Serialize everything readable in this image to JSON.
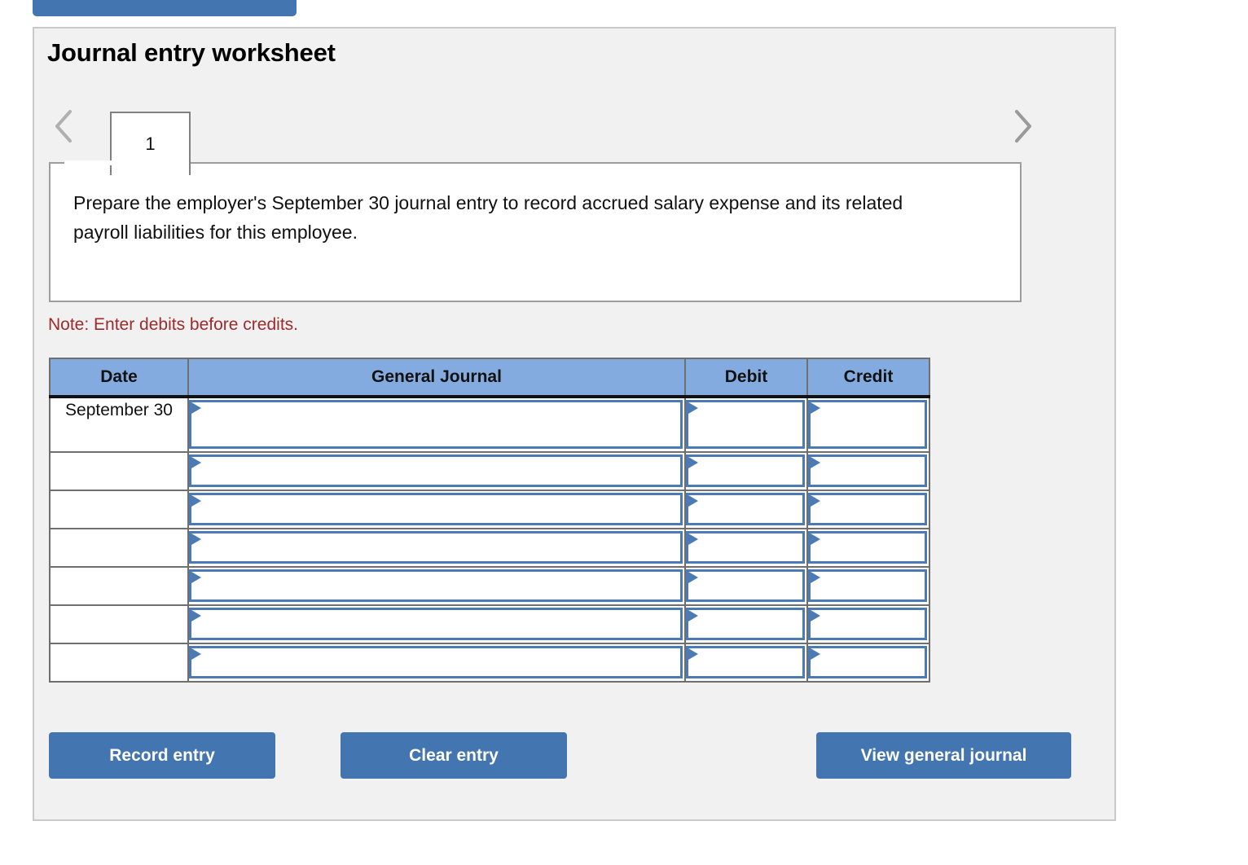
{
  "top_button": {
    "partial": true,
    "color": "#4375b0"
  },
  "panel": {
    "title": "Journal entry worksheet",
    "background": "#f1f1f1",
    "border_color": "#c9c9c9"
  },
  "tabs": {
    "prev_icon": "chevron-left-icon",
    "next_icon": "chevron-right-icon",
    "items": [
      {
        "label": "1",
        "active": true
      }
    ]
  },
  "instruction": {
    "text": "Prepare the employer's September 30 journal entry to record accrued salary expense and its related payroll liabilities for this employee."
  },
  "note": {
    "text": "Note: Enter debits before credits.",
    "color": "#9e2a2b"
  },
  "table": {
    "header_color": "#84abe0",
    "input_border_color": "#4b7ab5",
    "columns": [
      "Date",
      "General Journal",
      "Debit",
      "Credit"
    ],
    "rows": [
      {
        "date": "September 30",
        "general_journal": "",
        "debit": "",
        "credit": "",
        "tall": true
      },
      {
        "date": "",
        "general_journal": "",
        "debit": "",
        "credit": "",
        "tall": false
      },
      {
        "date": "",
        "general_journal": "",
        "debit": "",
        "credit": "",
        "tall": false
      },
      {
        "date": "",
        "general_journal": "",
        "debit": "",
        "credit": "",
        "tall": false
      },
      {
        "date": "",
        "general_journal": "",
        "debit": "",
        "credit": "",
        "tall": false
      },
      {
        "date": "",
        "general_journal": "",
        "debit": "",
        "credit": "",
        "tall": false
      },
      {
        "date": "",
        "general_journal": "",
        "debit": "",
        "credit": "",
        "tall": false
      }
    ]
  },
  "actions": {
    "record_label": "Record entry",
    "clear_label": "Clear entry",
    "view_label": "View general journal",
    "color": "#4375b0"
  }
}
